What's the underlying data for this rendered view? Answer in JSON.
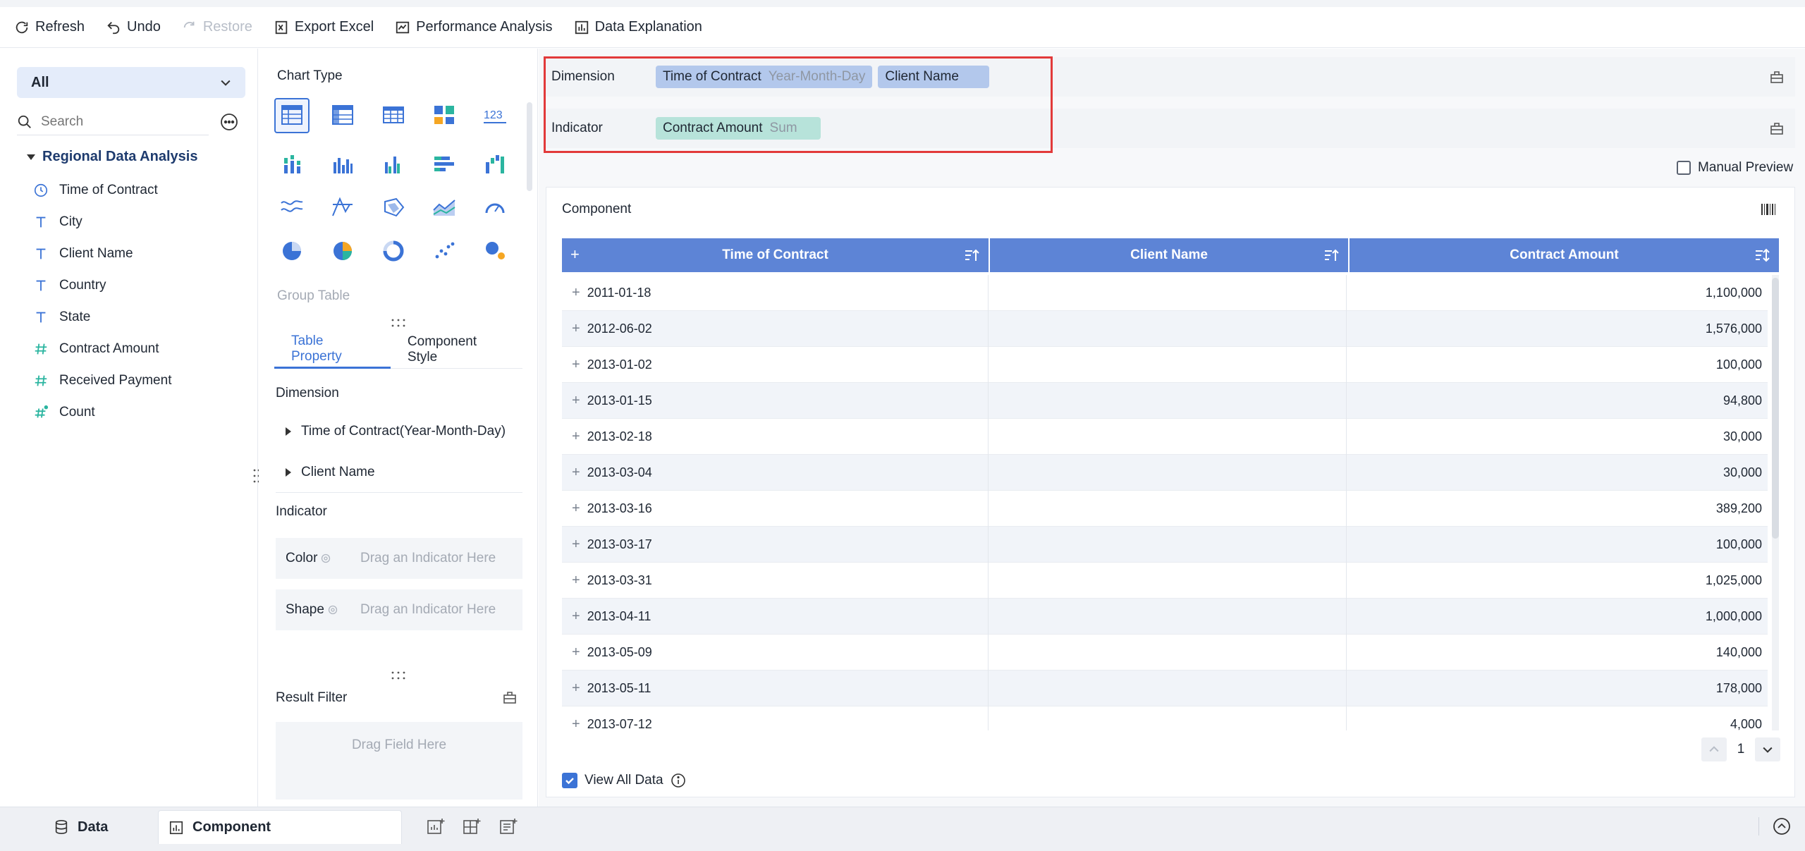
{
  "toolbar": {
    "refresh": "Refresh",
    "undo": "Undo",
    "restore": "Restore",
    "export_excel": "Export Excel",
    "performance": "Performance Analysis",
    "data_explanation": "Data Explanation"
  },
  "left": {
    "dataset_select": "All",
    "search_placeholder": "Search",
    "tree_title": "Regional Data Analysis",
    "fields": [
      {
        "label": "Time of Contract",
        "icon": "clock-icon"
      },
      {
        "label": "City",
        "icon": "text-type-icon"
      },
      {
        "label": "Client Name",
        "icon": "text-type-icon"
      },
      {
        "label": "Country",
        "icon": "text-type-icon"
      },
      {
        "label": "State",
        "icon": "text-type-icon"
      },
      {
        "label": "Contract Amount",
        "icon": "number-type-icon"
      },
      {
        "label": "Received Payment",
        "icon": "number-type-icon"
      },
      {
        "label": "Count",
        "icon": "count-icon"
      }
    ]
  },
  "middle": {
    "chart_type_title": "Chart Type",
    "group_table_label": "Group Table",
    "tabs": [
      "Table Property",
      "Component Style"
    ],
    "dimension_label": "Dimension",
    "dimension_items": [
      "Time of Contract(Year-Month-Day)",
      "Client Name"
    ],
    "indicator_label": "Indicator",
    "color_label": "Color",
    "shape_label": "Shape",
    "drag_indicator_hint": "Drag an Indicator Here",
    "result_filter": "Result Filter",
    "drag_field_hint": "Drag Field Here"
  },
  "shelves": {
    "dimension_label": "Dimension",
    "dimension_pills": [
      {
        "name": "Time of Contract",
        "sub": "Year-Month-Day"
      },
      {
        "name": "Client Name",
        "sub": ""
      }
    ],
    "indicator_label": "Indicator",
    "indicator_pills": [
      {
        "name": "Contract Amount",
        "sub": "Sum"
      }
    ]
  },
  "manual_preview": "Manual Preview",
  "component": {
    "title": "Component",
    "columns": [
      "Time of Contract",
      "Client Name",
      "Contract Amount"
    ],
    "rows": [
      {
        "date": "2011-01-18",
        "client": "",
        "amount": "1,100,000"
      },
      {
        "date": "2012-06-02",
        "client": "",
        "amount": "1,576,000"
      },
      {
        "date": "2013-01-02",
        "client": "",
        "amount": "100,000"
      },
      {
        "date": "2013-01-15",
        "client": "",
        "amount": "94,800"
      },
      {
        "date": "2013-02-18",
        "client": "",
        "amount": "30,000"
      },
      {
        "date": "2013-03-04",
        "client": "",
        "amount": "30,000"
      },
      {
        "date": "2013-03-16",
        "client": "",
        "amount": "389,200"
      },
      {
        "date": "2013-03-17",
        "client": "",
        "amount": "100,000"
      },
      {
        "date": "2013-03-31",
        "client": "",
        "amount": "1,025,000"
      },
      {
        "date": "2013-04-11",
        "client": "",
        "amount": "1,000,000"
      },
      {
        "date": "2013-05-09",
        "client": "",
        "amount": "140,000"
      },
      {
        "date": "2013-05-11",
        "client": "",
        "amount": "178,000"
      },
      {
        "date": "2013-07-12",
        "client": "",
        "amount": "4,000"
      }
    ],
    "page": "1",
    "view_all": "View All Data"
  },
  "bottom": {
    "data_tab": "Data",
    "component_tab": "Component"
  },
  "colors": {
    "accent": "#3b73d6",
    "table_header": "#5d84d6",
    "dim_pill": "#b3c8ec",
    "ind_pill": "#b7e3da",
    "highlight": "#e23a3a"
  }
}
